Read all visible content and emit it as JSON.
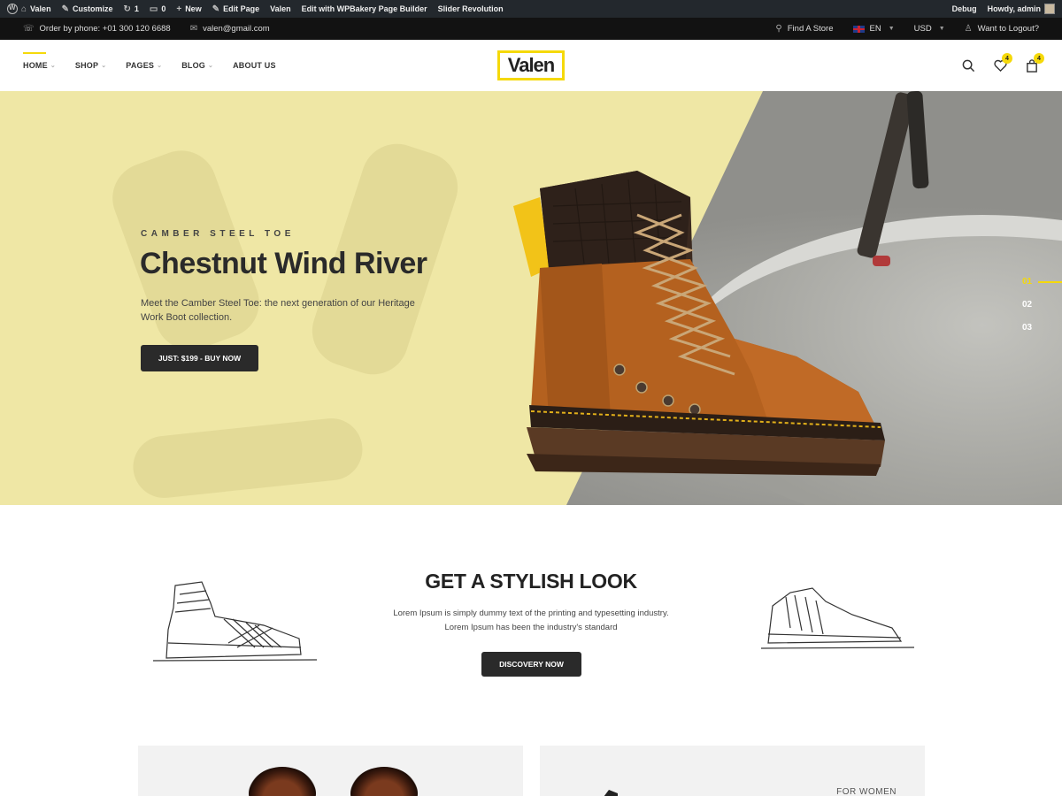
{
  "adminbar": {
    "site": "Valen",
    "customize": "Customize",
    "updates": "1",
    "comments": "0",
    "new": "New",
    "edit_page": "Edit Page",
    "valen": "Valen",
    "wpbakery": "Edit with WPBakery Page Builder",
    "slider": "Slider Revolution",
    "debug": "Debug",
    "howdy": "Howdy, admin"
  },
  "topbar": {
    "phone": "Order by phone: +01 300 120 6688",
    "email": "valen@gmail.com",
    "find_store": "Find A Store",
    "language": "EN",
    "currency": "USD",
    "logout": "Want to Logout?"
  },
  "nav": {
    "items": [
      "HOME",
      "SHOP",
      "PAGES",
      "BLOG",
      "ABOUT US"
    ]
  },
  "logo": "Valen",
  "header_icons": {
    "wishlist_count": "4",
    "cart_count": "4"
  },
  "hero": {
    "kicker": "CAMBER STEEL TOE",
    "title": "Chestnut Wind River",
    "description": "Meet the Camber Steel Toe: the next generation of our Heritage Work Boot collection.",
    "button": "JUST: $199 - BUY NOW",
    "slides": [
      "01",
      "02",
      "03"
    ],
    "colors": {
      "accent": "#f5d90a",
      "panel": "#efe7a5",
      "button": "#2a2a2a"
    }
  },
  "stylish": {
    "title": "GET A STYLISH LOOK",
    "desc_line1": "Lorem Ipsum is simply dummy text of the printing and typesetting industry.",
    "desc_line2": "Lorem Ipsum has been the industry's standard",
    "button": "DISCOVERY NOW"
  },
  "banners": {
    "right_label": "FOR WOMEN"
  }
}
